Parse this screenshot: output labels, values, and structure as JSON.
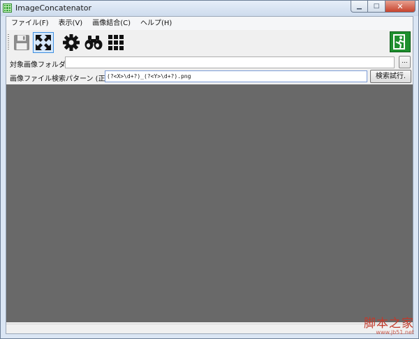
{
  "window": {
    "title": "ImageConcatenator"
  },
  "menu": [
    {
      "label": "ファイル(F)"
    },
    {
      "label": "表示(V)"
    },
    {
      "label": "画像結合(C)"
    },
    {
      "label": "ヘルプ(H)"
    }
  ],
  "toolbar": {
    "icons": [
      "save-icon",
      "fit-icon",
      "settings-icon",
      "binoculars-icon",
      "grid-icon",
      "exit-icon"
    ]
  },
  "folder": {
    "label": "対象画像フォルダ",
    "value": "",
    "browse_label": "..."
  },
  "pattern": {
    "label": "画像ファイル検索パターン (正規表",
    "value": "(?<X>\\d+?)_(?<Y>\\d+?).png",
    "search_label": "検索試行."
  },
  "watermark": {
    "main": "脚本之家",
    "sub": "www.jb51.net"
  },
  "colors": {
    "canvas": "#696969",
    "exit_green": "#1f8f2f"
  }
}
